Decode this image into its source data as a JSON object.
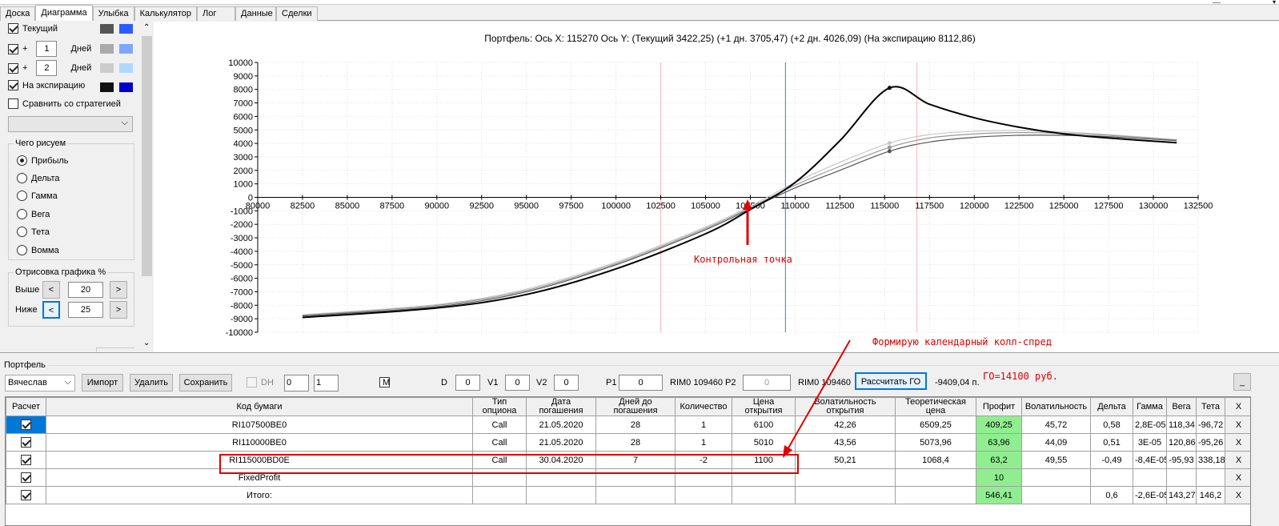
{
  "tabs": [
    "Доска",
    "Диаграмма",
    "Улыбка",
    "Калькулятор",
    "Лог",
    "Данные",
    "Сделки"
  ],
  "left": {
    "current_label": "Текущий",
    "plus": "+",
    "days_label": "Дней",
    "day1": "1",
    "day2": "2",
    "expiry_label": "На экспирацию",
    "compare_label": "Сравнить со стратегией",
    "draw_group": "Чего рисуем",
    "radios": [
      "Прибыль",
      "Дельта",
      "Гамма",
      "Вега",
      "Тета",
      "Вомма"
    ],
    "render_group": "Отрисовка графика %",
    "above_label": "Выше",
    "below_label": "Ниже",
    "above_value": "20",
    "below_value": "25",
    "left_arrow": "<",
    "right_arrow": ">"
  },
  "chart_data": {
    "type": "line",
    "title": "Портфель: Ось X: 115270 Ось Y: (Текущий 3422,25) (+1 дн. 3705,47) (+2 дн. 4026,09) (На экспирацию 8112,86)",
    "xlim": [
      80000,
      132500
    ],
    "ylim": [
      -10000,
      10000
    ],
    "xticks": [
      "80000",
      "82500",
      "85000",
      "87500",
      "90000",
      "92500",
      "95000",
      "97500",
      "100000",
      "102500",
      "105000",
      "107500",
      "110000",
      "112500",
      "115000",
      "117500",
      "120000",
      "122500",
      "125000",
      "127500",
      "130000",
      "132500"
    ],
    "yticks": [
      "10000",
      "9000",
      "8000",
      "7000",
      "6000",
      "5000",
      "4000",
      "3000",
      "2000",
      "1000",
      "0",
      "-1000",
      "-2000",
      "-3000",
      "-4000",
      "-5000",
      "-6000",
      "-7000",
      "-8000",
      "-9000",
      "-10000"
    ],
    "vlines": [
      {
        "x": 102500,
        "color": "#ffb6c1"
      },
      {
        "x": 109460,
        "color": "#4a7fb0"
      },
      {
        "x": 116800,
        "color": "#ffb6c1"
      }
    ],
    "series": [
      {
        "color": "#000000",
        "x": [
          82500,
          90000,
          95000,
          100000,
          105000,
          107500,
          110000,
          112500,
          115270,
          117500,
          120000,
          122500,
          125000,
          127500,
          131300
        ],
        "y": [
          -8900,
          -8200,
          -7200,
          -5300,
          -2700,
          -900,
          1100,
          4200,
          8113,
          6900,
          5900,
          5200,
          4700,
          4400,
          4050
        ]
      },
      {
        "color": "#555555",
        "x": [
          82500,
          90000,
          95000,
          100000,
          105000,
          107500,
          110000,
          112500,
          115270,
          117500,
          120000,
          122500,
          125000,
          127500,
          131300
        ],
        "y": [
          -8800,
          -8100,
          -7000,
          -5000,
          -2400,
          -850,
          700,
          2000,
          3422,
          4100,
          4450,
          4600,
          4600,
          4500,
          4200
        ]
      },
      {
        "color": "#999999",
        "x": [
          82500,
          90000,
          95000,
          100000,
          105000,
          107500,
          110000,
          112500,
          115270,
          117500,
          120000,
          122500,
          125000,
          127500,
          131300
        ],
        "y": [
          -8750,
          -8000,
          -6900,
          -4900,
          -2300,
          -750,
          900,
          2300,
          3705,
          4400,
          4700,
          4800,
          4750,
          4600,
          4250
        ]
      },
      {
        "color": "#c8c8c8",
        "x": [
          82500,
          90000,
          95000,
          100000,
          105000,
          107500,
          110000,
          112500,
          115270,
          117500,
          120000,
          122500,
          125000,
          127500,
          131300
        ],
        "y": [
          -8700,
          -7950,
          -6800,
          -4800,
          -2200,
          -650,
          1100,
          2600,
          4026,
          4650,
          4900,
          4950,
          4850,
          4650,
          4280
        ]
      }
    ],
    "annotation1": "Контрольная точка",
    "annotation2": "Формирую календарный колл-спред"
  },
  "portfolio": {
    "section_label": "Портфель",
    "owner": "Вячеслав",
    "import": "Импорт",
    "delete": "Удалить",
    "save": "Сохранить",
    "dh": "DH",
    "dh1": "0",
    "dh2": "1",
    "m": "M",
    "d_label": "D",
    "d_val": "0",
    "v1_label": "V1",
    "v1_val": "0",
    "v2_label": "V2",
    "v2_val": "0",
    "p1_label": "P1",
    "p1_val": "0",
    "rim1": "RIM0 109460",
    "p2_label": "P2",
    "p2_val": "0",
    "rim2": "RIM0 109460",
    "calc_go": "Рассчитать ГО",
    "pnl": "-9409,04 п.",
    "go_note": "ГО=14100 руб.",
    "min": "_"
  },
  "table": {
    "headers": [
      "Расчет",
      "Код бумаги",
      "Тип опциона",
      "Дата погашения",
      "Дней до погашения",
      "Количество",
      "Цена открытия",
      "Волатильность открытия",
      "Теоретическая цена",
      "Профит",
      "Волатильность",
      "Дельта",
      "Гамма",
      "Вега",
      "Тета",
      "X"
    ],
    "rows": [
      [
        "RI107500BE0",
        "Call",
        "21.05.2020",
        "28",
        "1",
        "6100",
        "42,26",
        "6509,25",
        "409,25",
        "45,72",
        "0,58",
        "2,8E-05",
        "118,34",
        "-96,72",
        "X"
      ],
      [
        "RI110000BE0",
        "Call",
        "21.05.2020",
        "28",
        "1",
        "5010",
        "43,56",
        "5073,96",
        "63,96",
        "44,09",
        "0,51",
        "3E-05",
        "120,86",
        "-95,26",
        "X"
      ],
      [
        "RI115000BD0E",
        "Call",
        "30.04.2020",
        "7",
        "-2",
        "1100",
        "50,21",
        "1068,4",
        "63,2",
        "49,55",
        "-0,49",
        "-8,4E-05",
        "-95,93",
        "338,18",
        "X"
      ],
      [
        "FixedProfit",
        "",
        "",
        "",
        "",
        "",
        "",
        "",
        "10",
        "",
        "",
        "",
        "",
        "",
        "X"
      ],
      [
        "Итого:",
        "",
        "",
        "",
        "",
        "",
        "",
        "",
        "546,41",
        "",
        "0,6",
        "-2,6E-05",
        "143,27",
        "146,2",
        "X"
      ]
    ]
  }
}
